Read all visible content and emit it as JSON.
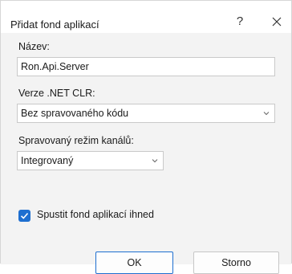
{
  "window": {
    "title": "Přidat fond aplikací",
    "help_glyph": "?",
    "close_glyph": "×"
  },
  "form": {
    "name_label": "Název:",
    "name_value": "Ron.Api.Server",
    "clr_label": "Verze .NET CLR:",
    "clr_value": "Bez spravovaného kódu",
    "pipeline_label": "Spravovaný režim kanálů:",
    "pipeline_value": "Integrovaný",
    "start_checkbox_label": "Spustit fond aplikací ihned",
    "start_checked": true
  },
  "buttons": {
    "ok": "OK",
    "cancel": "Storno"
  },
  "colors": {
    "accent": "#1e6fd0"
  }
}
